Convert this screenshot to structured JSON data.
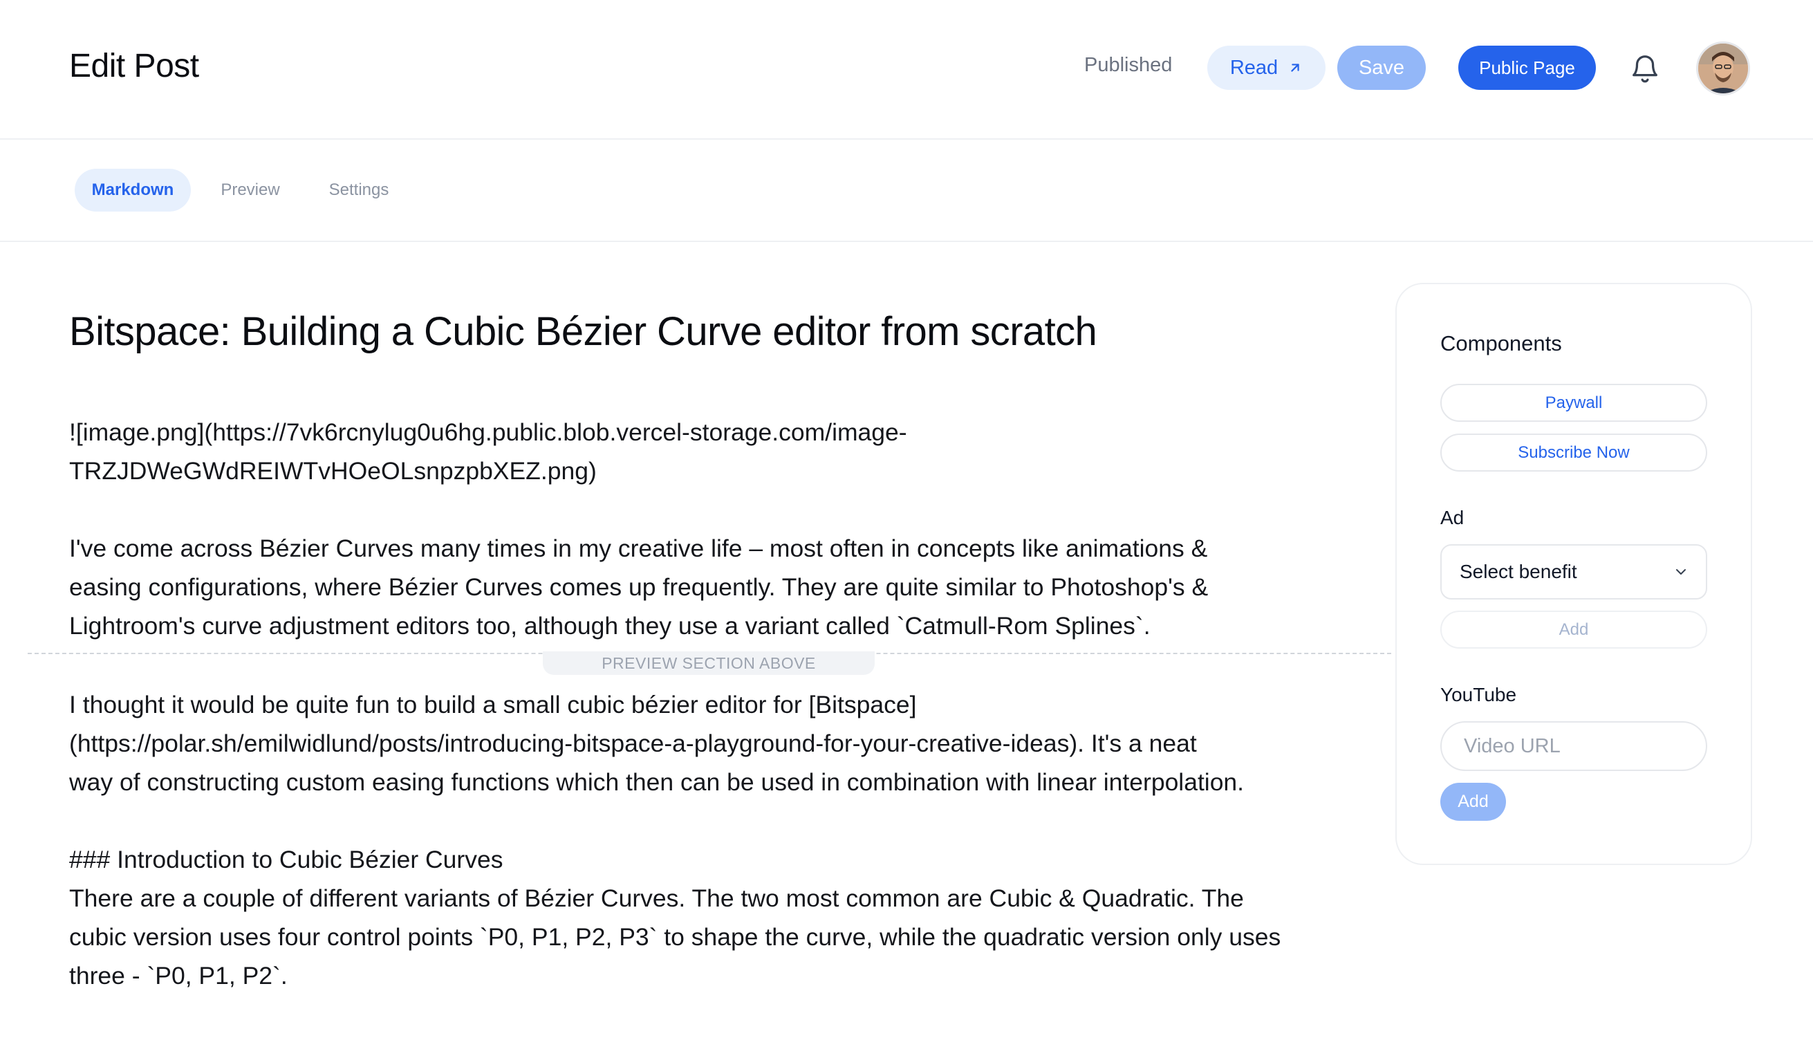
{
  "header": {
    "title": "Edit Post",
    "status": "Published",
    "read_label": "Read",
    "save_label": "Save",
    "public_page_label": "Public Page"
  },
  "tabs": [
    {
      "label": "Markdown",
      "active": true
    },
    {
      "label": "Preview",
      "active": false
    },
    {
      "label": "Settings",
      "active": false
    }
  ],
  "editor": {
    "title": "Bitspace: Building a Cubic Bézier Curve editor from scratch",
    "image_line_1": "![image.png](https://7vk6rcnylug0u6hg.public.blob.vercel-storage.com/image-",
    "image_line_2": "TRZJDWeGWdREIWTvHOeOLsnpzpbXEZ.png)",
    "para1": [
      "I've come across Bézier Curves many times in my creative life – most often in concepts like animations &",
      "easing configurations, where Bézier Curves comes up frequently. They are quite similar to Photoshop's &",
      "Lightroom's curve adjustment editors too, although they use a variant called `Catmull-Rom Splines`."
    ],
    "divider_label": "PREVIEW SECTION ABOVE",
    "para2": [
      "I thought it would be quite fun to build a small cubic bézier editor for [Bitspace]",
      "(https://polar.sh/emilwidlund/posts/introducing-bitspace-a-playground-for-your-creative-ideas). It's a neat",
      "way of constructing custom easing functions which then can be used in combination with linear interpolation."
    ],
    "heading": "### Introduction to Cubic Bézier Curves",
    "para3": [
      "There are a couple of different variants of Bézier Curves. The two most common are Cubic & Quadratic. The",
      "cubic version uses four control points `P0, P1, P2, P3` to shape the curve, while the quadratic version only uses",
      "three - `P0, P1, P2`."
    ]
  },
  "sidebar": {
    "components_heading": "Components",
    "paywall_label": "Paywall",
    "subscribe_label": "Subscribe Now",
    "ad_label": "Ad",
    "ad_select_value": "Select benefit",
    "ad_add_label": "Add",
    "youtube_label": "YouTube",
    "youtube_placeholder": "Video URL",
    "youtube_add_label": "Add"
  },
  "icons": {
    "read": "arrow-up-right-icon",
    "notifications": "bell-icon",
    "select": "chevron-down-icon"
  },
  "colors": {
    "accent": "#2563eb",
    "accent_light": "#e7f0fd",
    "accent_disabled": "#93b7f8"
  }
}
